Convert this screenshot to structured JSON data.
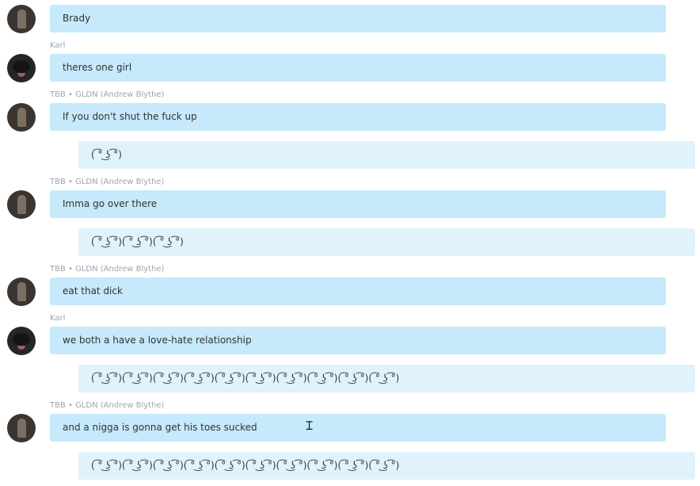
{
  "messages": [
    {
      "sender": "",
      "avatar": "andrew",
      "text": "Brady"
    },
    {
      "sender": "Karl",
      "avatar": "karl",
      "text": "theres one girl"
    },
    {
      "sender": "TBB • GLDN (Andrew Blythe)",
      "avatar": "andrew",
      "text": "If you don't shut the fuck up"
    },
    {
      "text": "( ͡° ͜ʖ ͡°)"
    },
    {
      "sender": "TBB • GLDN (Andrew Blythe)",
      "avatar": "andrew",
      "text": "Imma go over there"
    },
    {
      "text": "( ͡° ͜ʖ ͡°)( ͡° ͜ʖ ͡°)( ͡° ͜ʖ ͡°)"
    },
    {
      "sender": "TBB • GLDN (Andrew Blythe)",
      "avatar": "andrew",
      "text": "eat that dick"
    },
    {
      "sender": "Karl",
      "avatar": "karl",
      "text": "we both a have a love-hate relationship"
    },
    {
      "text": "( ͡° ͜ʖ ͡°)( ͡° ͜ʖ ͡°)( ͡° ͜ʖ ͡°)( ͡° ͜ʖ ͡°)( ͡° ͜ʖ ͡°)( ͡° ͜ʖ ͡°)( ͡° ͜ʖ ͡°)( ͡° ͜ʖ ͡°)( ͡° ͜ʖ ͡°)( ͡° ͜ʖ ͡°)"
    },
    {
      "sender": "TBB • GLDN (Andrew Blythe)",
      "avatar": "andrew",
      "text": "and a nigga is gonna get his toes sucked"
    },
    {
      "text": "( ͡° ͜ʖ ͡°)( ͡° ͜ʖ ͡°)( ͡° ͜ʖ ͡°)( ͡° ͜ʖ ͡°)( ͡° ͜ʖ ͡°)( ͡° ͜ʖ ͡°)( ͡° ͜ʖ ͡°)( ͡° ͜ʖ ͡°)( ͡° ͜ʖ ͡°)( ͡° ͜ʖ ͡°)"
    }
  ],
  "cursor_icon": "text-cursor-icon"
}
